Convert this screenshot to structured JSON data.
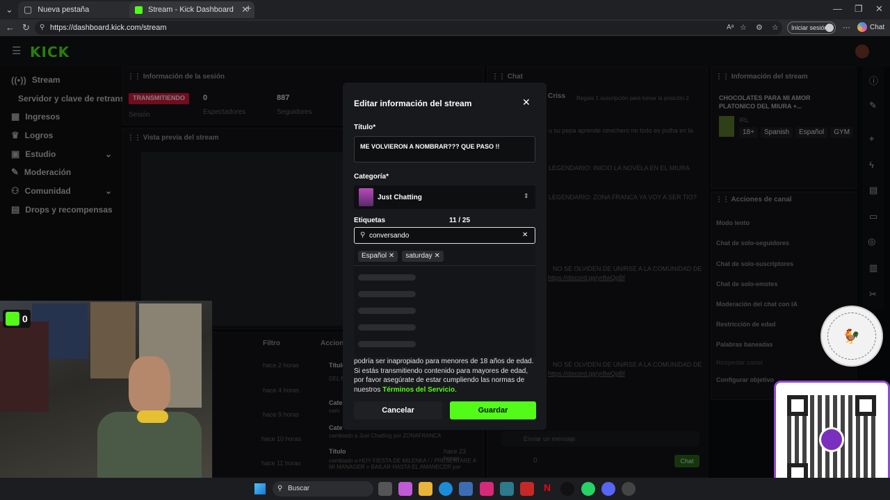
{
  "browser": {
    "tabs": [
      {
        "title": "Nueva pestaña",
        "active": false
      },
      {
        "title": "Stream - Kick Dashboard",
        "active": true
      }
    ],
    "url": "https://dashboard.kick.com/stream",
    "signin_label": "Iniciar sesión",
    "chat_label": "Chat"
  },
  "dashboard": {
    "logo": "KICK",
    "sidebar": [
      {
        "label": "Stream",
        "icon": "broadcast-icon"
      },
      {
        "label": "Servidor y clave de retransm",
        "icon": ""
      },
      {
        "label": "Ingresos",
        "icon": "grid-icon"
      },
      {
        "label": "Logros",
        "icon": "trophy-icon"
      },
      {
        "label": "Estudio",
        "icon": "layout-icon"
      },
      {
        "label": "Moderación",
        "icon": "wrench-icon"
      },
      {
        "label": "Comunidad",
        "icon": "users-icon"
      },
      {
        "label": "Drops y recompensas",
        "icon": "gift-icon"
      }
    ],
    "session": {
      "title": "Información de la sesión",
      "status": "TRANSMITIENDO",
      "session_label": "Sesión",
      "viewers": "0",
      "viewers_label": "Espectadores",
      "followers": "887",
      "followers_label": "Seguidores"
    },
    "preview_title": "Vista previa del stream",
    "chat": {
      "title": "Chat",
      "pinned_user": "Criss",
      "pinned_text": "Regala 1 suscripción para tomar la posición 2",
      "messages": [
        "u su pepa aprende cevichero no todo es putha en la",
        "LEGENDARIO: INICIO LA NOVELA EN EL MIURA",
        "LEGENDARIO: ZONA FRANCA YA VOY A SER TIO?",
        "NO SE OLVIDEN DE UNIRSE A LA COMUNIDAD DE",
        "https://discord.gg/yr8wQpBf",
        "NO SE OLVIDEN DE UNIRSE A LA COMUNIDAD DE",
        "https://discord.gg/yr8wQpBf"
      ],
      "input_placeholder": "Enviar un mensaje",
      "count": "0",
      "send_label": "Chat"
    },
    "stream_info": {
      "title": "Información del stream",
      "stream_title": "CHOCOLATES PARA MI AMOR PLATONICO DEL MIURA +...",
      "category": "IRL",
      "tags": [
        "18+",
        "Spanish",
        "Español",
        "GYM"
      ]
    },
    "channel_actions": {
      "title": "Acciones de canal",
      "items": [
        "Modo lento",
        "Chat de solo-seguidores",
        "Chat de solo-suscriptores",
        "Chat de solo-emotes",
        "Moderación del chat con IA",
        "Restricción de edad",
        "Palabras baneadas",
        "Hospedar canal",
        "Configurar objetivo"
      ]
    },
    "activity": {
      "filter_label": "Filtro",
      "actions_label": "Acciones",
      "times": [
        "hace 2 horas",
        "hace 4 horas",
        "hace 9 horas",
        "hace 10 horas",
        "hace 11 horas"
      ],
      "entries": [
        {
          "title": "Título",
          "detail": "DEL M ZONA"
        },
        {
          "title": "Cate",
          "detail": "cam"
        },
        {
          "title": "Cate",
          "detail": "cambiado a Just Chatting por ZONAFRANCA"
        },
        {
          "title": "Título",
          "detail": "cambiado a HOY FIESTA DE MILENKA ! / PRESENTARE A MI MANAGER + BAILAR HASTA EL AMANECER por",
          "time": "hace 23 horas"
        }
      ]
    }
  },
  "modal": {
    "title": "Editar información del stream",
    "title_label": "Título*",
    "title_value": "ME VOLVIERON A NOMBRAR??? QUE PASO !!",
    "category_label": "Categoría*",
    "category_value": "Just Chatting",
    "tags_label": "Etiquetas",
    "tags_count": "11 / 25",
    "tag_input_value": "conversando",
    "tags": [
      "Español",
      "saturday"
    ],
    "notice_prefix": "podría ser inapropiado para menores de 18 años de edad. Si estás transmitiendo contenido para mayores de edad, por favor asegúrate de estar cumpliendo las normas de nuestros ",
    "notice_link": "Términos del Servicio",
    "notice_suffix": ".",
    "cancel_label": "Cancelar",
    "save_label": "Guardar"
  },
  "overlay": {
    "kick_count": "0",
    "badge_text": "NUEVOS YAHAY"
  },
  "taskbar": {
    "search_label": "Buscar"
  },
  "colors": {
    "accent": "#53fc18",
    "live": "#e5193f",
    "qr_border": "#8e4ad0"
  }
}
